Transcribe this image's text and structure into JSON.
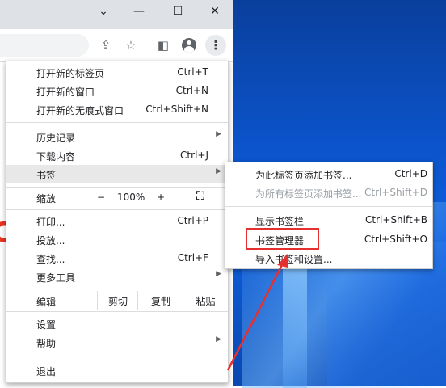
{
  "window": {
    "minimize_icon": "minimize-icon",
    "maximize_icon": "maximize-icon",
    "close_icon": "close-icon",
    "tab_strip_chevron": "chevron-down-icon"
  },
  "toolbar": {
    "icons": [
      "share-icon",
      "star-icon",
      "side-panel-icon",
      "profile-icon",
      "kebab-menu-icon"
    ]
  },
  "menu": {
    "new_tab": {
      "label": "打开新的标签页",
      "shortcut": "Ctrl+T"
    },
    "new_window": {
      "label": "打开新的窗口",
      "shortcut": "Ctrl+N"
    },
    "incognito": {
      "label": "打开新的无痕式窗口",
      "shortcut": "Ctrl+Shift+N"
    },
    "history": {
      "label": "历史记录"
    },
    "downloads": {
      "label": "下载内容",
      "shortcut": "Ctrl+J"
    },
    "bookmarks": {
      "label": "书签"
    },
    "zoom": {
      "label": "缩放",
      "minus": "−",
      "value": "100%",
      "plus": "+"
    },
    "print": {
      "label": "打印...",
      "shortcut": "Ctrl+P"
    },
    "cast": {
      "label": "投放..."
    },
    "find": {
      "label": "查找...",
      "shortcut": "Ctrl+F"
    },
    "more_tools": {
      "label": "更多工具"
    },
    "edit": {
      "label": "编辑",
      "cut": "剪切",
      "copy": "复制",
      "paste": "粘贴"
    },
    "settings": {
      "label": "设置"
    },
    "help": {
      "label": "帮助"
    },
    "exit": {
      "label": "退出"
    }
  },
  "bookmark_submenu": {
    "add_this": {
      "label": "为此标签页添加书签...",
      "shortcut": "Ctrl+D"
    },
    "add_all": {
      "label": "为所有标签页添加书签...",
      "shortcut": "Ctrl+Shift+D"
    },
    "show_bar": {
      "label": "显示书签栏",
      "shortcut": "Ctrl+Shift+B"
    },
    "manager": {
      "label": "书签管理器",
      "shortcut": "Ctrl+Shift+O"
    },
    "import": {
      "label": "导入书签和设置..."
    }
  },
  "annotation": {
    "highlight_color": "#e53030"
  }
}
